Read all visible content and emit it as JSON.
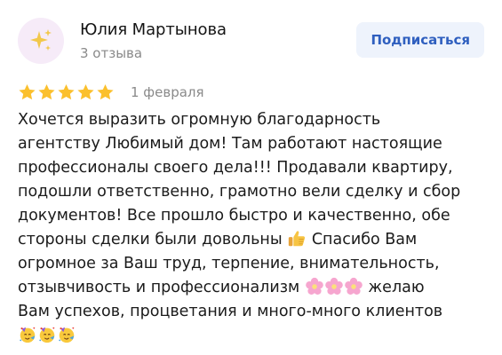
{
  "review": {
    "author": {
      "name": "Юлия Мартынова",
      "reviews_count": "3 отзыва",
      "avatar_icon": "sparkles-icon"
    },
    "subscribe_label": "Подписаться",
    "rating": 5,
    "rating_max": 5,
    "date": "1 февраля",
    "text_lines": [
      "Хочется выразить огромную благодарность",
      "агентству Любимый дом! Там работают настоящие",
      "профессионалы своего дела!!! Продавали квартиру,",
      "подошли ответственно, грамотно вели сделку и сбор",
      "документов! Все прошло быстро и качественно, обе",
      "стороны сделки были довольны",
      "Спасибо Вам",
      "огромное за Ваш труд, терпение, внимательность,",
      "отзывчивость и профессионализм",
      "желаю",
      "Вам успехов, процветания и много-много клиентов"
    ],
    "emojis": {
      "thumbs_up": "thumbs-up-icon",
      "flower": "cherry-blossom-icon",
      "party_face": "partying-face-icon"
    }
  },
  "colors": {
    "star": "#fbc02d",
    "subscribe_bg": "#eef3fc",
    "subscribe_text": "#2f5fbf",
    "secondary_text": "#8a8a8a"
  }
}
